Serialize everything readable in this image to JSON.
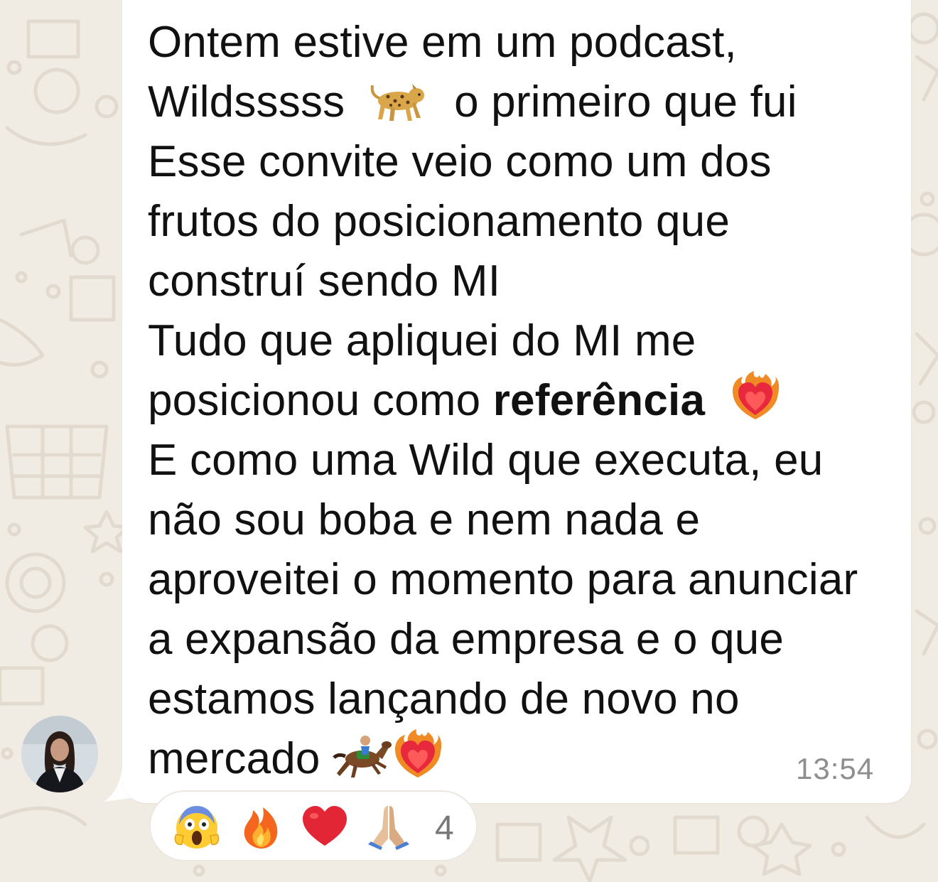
{
  "message": {
    "lines": [
      "Ontem estive em um podcast,",
      "Wildsssss",
      "o primeiro que fui",
      "Esse convite veio como um dos",
      "frutos do posicionamento que",
      "construí sendo MI",
      "Tudo que apliquei do MI me",
      "posicionou como",
      "referência",
      "E como uma Wild que executa, eu",
      "não sou boba e nem nada e",
      "aproveitei o momento para anunciar",
      "a expansão da empresa e o que",
      "estamos lançando de novo no",
      "mercado"
    ],
    "time": "13:54"
  },
  "reactions": {
    "emojis": [
      "face-screaming-in-fear-icon",
      "fire-icon",
      "red-heart-icon",
      "folded-hands-icon"
    ],
    "count": "4"
  },
  "colors": {
    "background": "#f1ece3",
    "bubble": "#ffffff",
    "text": "#111111",
    "time": "#8e8e8e"
  }
}
